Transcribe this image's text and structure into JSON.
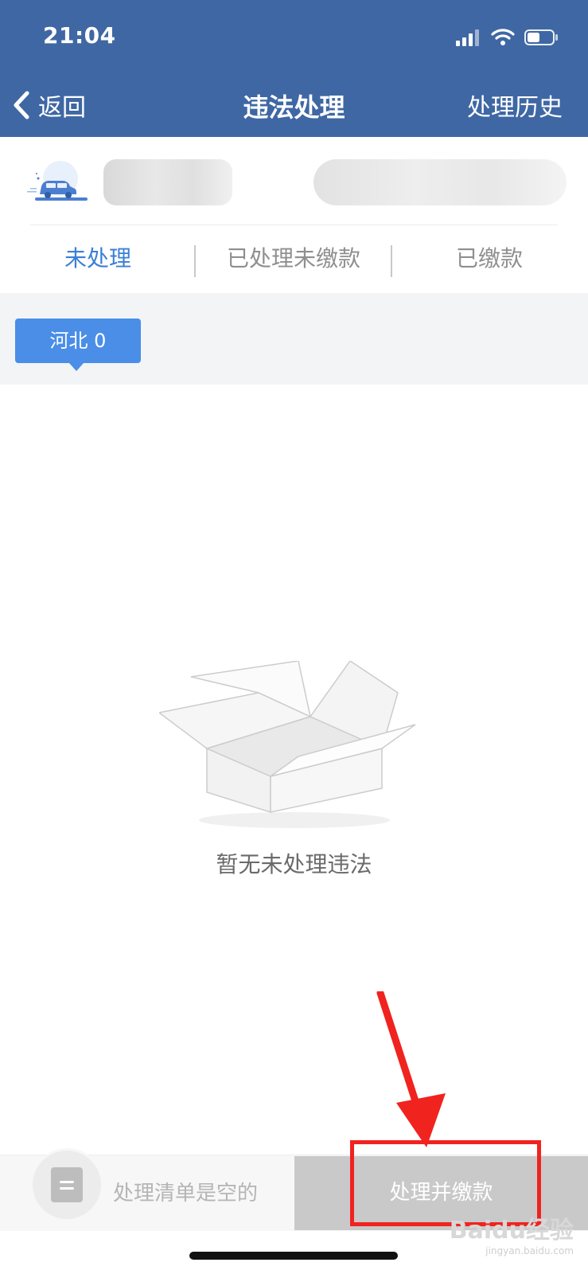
{
  "status_bar": {
    "time": "21:04"
  },
  "nav": {
    "back_label": "返回",
    "title": "违法处理",
    "right_label": "处理历史"
  },
  "tabs": [
    {
      "label": "未处理",
      "active": true
    },
    {
      "label": "已处理未缴款",
      "active": false
    },
    {
      "label": "已缴款",
      "active": false
    }
  ],
  "region": {
    "label": "河北 0"
  },
  "empty_state": {
    "message": "暂无未处理违法"
  },
  "bottom_bar": {
    "cart_text": "处理清单是空的",
    "pay_button_label": "处理并缴款"
  },
  "watermark": {
    "text": "Baidu经验",
    "sub": "jingyan.baidu.com"
  },
  "colors": {
    "header_bg": "#3f67a4",
    "accent_blue": "#3a7fd6",
    "chip_blue": "#4a8ee8",
    "annotation_red": "#f0231f"
  },
  "icons": {
    "back": "chevron-left-icon",
    "signal": "signal-icon",
    "wifi": "wifi-icon",
    "battery": "battery-icon",
    "vehicle": "car-icon",
    "empty": "empty-box-icon",
    "cart": "list-icon"
  }
}
